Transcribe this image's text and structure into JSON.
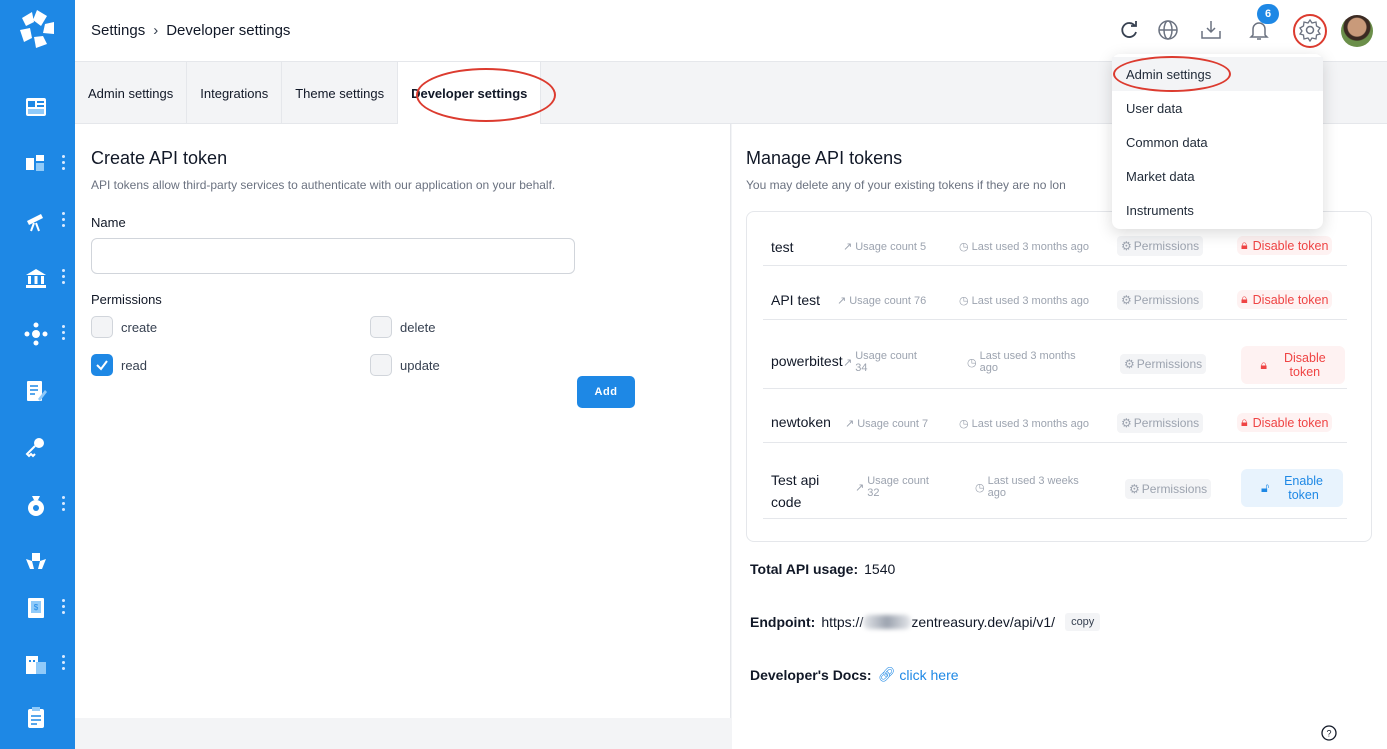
{
  "app": {
    "brand_color": "#1e88e5",
    "annotation_color": "#dc3b2f"
  },
  "breadcrumb": {
    "root": "Settings",
    "current": "Developer settings"
  },
  "header": {
    "notification_count": "6"
  },
  "tabs": [
    {
      "label": "Admin settings"
    },
    {
      "label": "Integrations"
    },
    {
      "label": "Theme settings"
    },
    {
      "label": "Developer settings",
      "active": true
    }
  ],
  "create": {
    "title": "Create API token",
    "subtitle": "API tokens allow third-party services to authenticate with our application on your behalf.",
    "name_label": "Name",
    "name_value": "",
    "permissions_label": "Permissions",
    "permissions": [
      {
        "label": "create",
        "checked": false
      },
      {
        "label": "delete",
        "checked": false
      },
      {
        "label": "read",
        "checked": true
      },
      {
        "label": "update",
        "checked": false
      }
    ],
    "add_label": "Add"
  },
  "manage": {
    "title": "Manage API tokens",
    "subtitle": "You may delete any of your existing tokens if they are no lon",
    "tokens": [
      {
        "name": "test",
        "usage": "Usage count 5",
        "last_used": "Last used 3 months ago",
        "permissions": "Permissions",
        "action": "Disable token"
      },
      {
        "name": "API test",
        "usage": "Usage count 76",
        "last_used": "Last used 3 months ago",
        "permissions": "Permissions",
        "action": "Disable token"
      },
      {
        "name": "powerbitest",
        "usage_a": "Usage count",
        "usage_b": "34",
        "last_a": "Last used 3 months",
        "last_b": "ago",
        "permissions": "Permissions",
        "action_a": "Disable",
        "action_b": "token"
      },
      {
        "name": "newtoken",
        "usage": "Usage count 7",
        "last_used": "Last used 3 months ago",
        "permissions": "Permissions",
        "action": "Disable token"
      },
      {
        "name_a": "Test api",
        "name_b": "code",
        "usage_a": "Usage count",
        "usage_b": "32",
        "last_a": "Last used 3 weeks",
        "last_b": "ago",
        "permissions": "Permissions",
        "action_a": "Enable",
        "action_b": "token"
      }
    ],
    "total_label": "Total API usage:",
    "total_value": "1540",
    "endpoint_label": "Endpoint:",
    "endpoint_prefix": "https://",
    "endpoint_suffix": "zentreasury.dev/api/v1/",
    "copy_label": "copy",
    "docs_label": "Developer's Docs:",
    "docs_link": "click here"
  },
  "dropdown": {
    "items": [
      {
        "label": "Admin settings"
      },
      {
        "label": "User data"
      },
      {
        "label": "Common data"
      },
      {
        "label": "Market data"
      },
      {
        "label": "Instruments"
      }
    ]
  }
}
